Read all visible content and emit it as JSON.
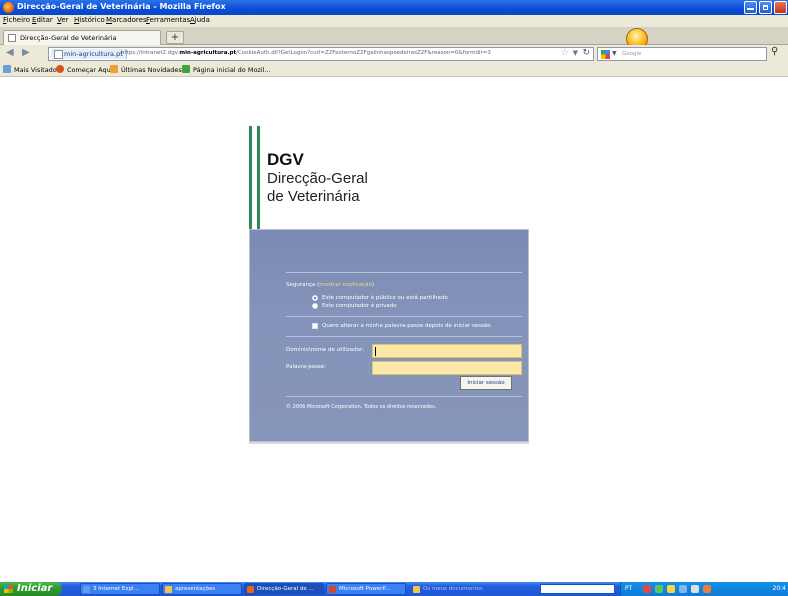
{
  "window": {
    "title": "Direcção-Geral de Veterinária - Mozilla Firefox"
  },
  "menu": [
    "Ficheiro",
    "Editar",
    "Ver",
    "Histórico",
    "Marcadores",
    "Ferramentas",
    "Ajuda"
  ],
  "tab": {
    "label": "Direcção-Geral de Veterinária",
    "new_tab_label": "+"
  },
  "nav": {
    "site_identity": "min-agricultura.pt",
    "url_prefix": "https://intranet2.dgv.",
    "url_domain": "min-agricultura.pt",
    "url_suffix": "/CookieAuth.dll?GetLogon?curl=Z2FexternoZ2FgalinhaspoedeirasZ2F&reason=0&formdir=3",
    "search_placeholder": "Google"
  },
  "bookmarks": [
    {
      "label": "Mais Visitados",
      "icon": "folder-icon",
      "color": "#6aa0d8"
    },
    {
      "label": "Começar Aqui",
      "icon": "firefox-icon",
      "color": "#d9531e"
    },
    {
      "label": "Últimas Novidades",
      "icon": "rss-icon",
      "color": "#f0a030"
    },
    {
      "label": "Página inicial do Mozil...",
      "icon": "puzzle-icon",
      "color": "#3aa63a"
    }
  ],
  "brand": {
    "acronym": "DGV",
    "line1": "Direcção-Geral",
    "line2": "de Veterinária",
    "accent_color": "#2e8b57"
  },
  "login": {
    "security_label": "Segurança (",
    "security_link": "mostrar explicação",
    "security_close": ")",
    "option_public": "Este computador é público ou está partilhado",
    "option_private": "Este computador é privado",
    "change_password_label": "Quero alterar a minha palavra-passe depois de iniciar sessão",
    "username_label": "Domínio\\nome de utilizador:",
    "password_label": "Palavra-passe:",
    "submit_label": "Iniciar sessão",
    "copyright": "© 2006 Microsoft Corporation. Todos os direitos reservados.",
    "selected_option": "public",
    "panel_color": "#8190b7",
    "input_color": "#fbe8a6"
  },
  "taskbar": {
    "start_label": "Iniciar",
    "items": [
      {
        "label": "3 Internet Expl...",
        "active": false,
        "color": "#5aa0f0"
      },
      {
        "label": "apresentações",
        "active": false,
        "color": "#f3c54a"
      },
      {
        "label": "Direcção-Geral de ...",
        "active": true,
        "color": "#e8651a"
      },
      {
        "label": "Microsoft PowerP...",
        "active": false,
        "color": "#d2472a"
      }
    ],
    "tray_hint": "Os meus documentos",
    "lang": "PT",
    "clock": "20:4"
  }
}
